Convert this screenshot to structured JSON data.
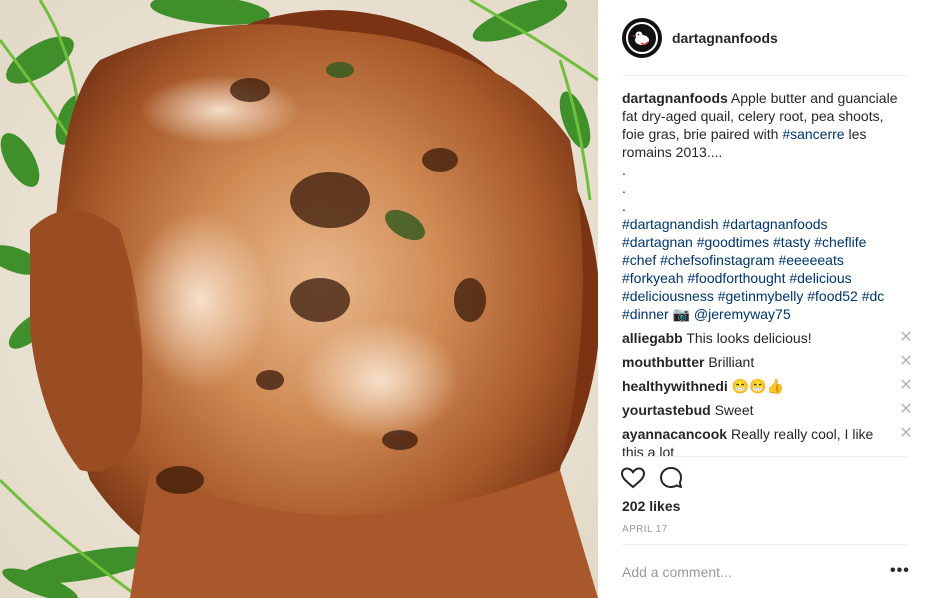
{
  "post": {
    "username": "dartagnanfoods",
    "caption_text": "Apple butter and guanciale fat dry-aged quail, celery root, pea shoots, foie gras, brie paired with",
    "caption_tag_inline": "#sancerre",
    "caption_tail": " les romains 2013....",
    "dots": [
      ".",
      ".",
      "."
    ],
    "hashtags": [
      "#dartagnandish",
      "#dartagnanfoods",
      "#dartagnan",
      "#goodtimes",
      "#tasty",
      "#cheflife",
      "#chef",
      "#chefsofinstagram",
      "#eeeeeats",
      "#forkyeah",
      "#foodforthought",
      "#delicious",
      "#deliciousness",
      "#getinmybelly",
      "#food52",
      "#dc",
      "#dinner"
    ],
    "camera_emoji": "📷",
    "credit": "@jeremyway75"
  },
  "comments": [
    {
      "user": "alliegabb",
      "text": "This looks delicious!"
    },
    {
      "user": "mouthbutter",
      "text": "Brilliant"
    },
    {
      "user": "healthywithnedi",
      "text": "😁😁👍"
    },
    {
      "user": "yourtastebud",
      "text": "Sweet"
    },
    {
      "user": "ayannacancook",
      "text": "Really really cool, I like this a lot"
    }
  ],
  "likes": "202 likes",
  "date": "APRIL 17",
  "add_comment_placeholder": "Add a comment...",
  "more_label": "•••",
  "close_glyph": "✕",
  "icons": {
    "like": "heart-icon",
    "comment": "speech-bubble-icon",
    "avatar": "duck-logo-icon"
  },
  "colors": {
    "hashtag": "#003569",
    "text": "#262626",
    "muted": "#999999"
  }
}
